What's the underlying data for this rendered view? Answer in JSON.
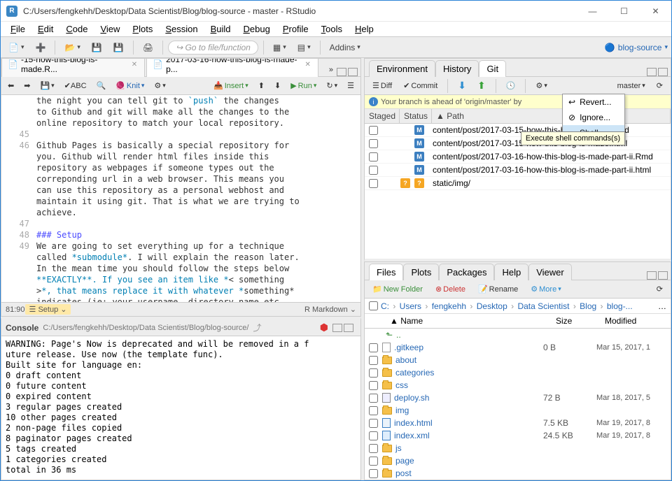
{
  "titlebar": {
    "text": "C:/Users/fengkehh/Desktop/Data Scientist/Blog/blog-source - master - RStudio"
  },
  "menu": [
    "File",
    "Edit",
    "Code",
    "View",
    "Plots",
    "Session",
    "Build",
    "Debug",
    "Profile",
    "Tools",
    "Help"
  ],
  "toolbar": {
    "goto": "Go to file/function",
    "addins": "Addins",
    "project": "blog-source"
  },
  "source": {
    "tabs": [
      {
        "label": "-15-how-this-blog-is-made.R...",
        "active": false
      },
      {
        "label": "2017-03-16-how-this-blog-is-made-p...",
        "active": true
      }
    ],
    "knit": "Knit",
    "insert": "Insert",
    "run": "Run",
    "lines": [
      {
        "n": "",
        "t": "the night you can tell git to `push` the changes\nto Github and git will make all the changes to the\nonline repository to match your local repository."
      },
      {
        "n": "45",
        "t": ""
      },
      {
        "n": "46",
        "t": "Github Pages is basically a special repository for\nyou. Github will render html files inside this\nrepository as webpages if someone types out the\ncorreponding url in a web browser. This means you\ncan use this repository as a personal webhost and\nmaintain it using git. That is what we are trying to\nachieve."
      },
      {
        "n": "47",
        "t": ""
      },
      {
        "n": "48",
        "t": "### Setup",
        "cls": "h3"
      },
      {
        "n": "49",
        "t": "We are going to set everything up for a technique\ncalled *submodule*. I will explain the reason later.\nIn the mean time you should follow the steps below\n**EXACTLY**. If you see an item like *< something\n>*, that means replace it with whatever *something*\nindicates (ie: your username, directory name etc"
      }
    ],
    "pos": "81:90",
    "chunk": "Setup",
    "lang": "R Markdown"
  },
  "console": {
    "title": "Console",
    "path": "C:/Users/fengkehh/Desktop/Data Scientist/Blog/blog-source/",
    "body": "WARNING: Page's Now is deprecated and will be removed in a f\nuture release. Use now (the template func).\nBuilt site for language en:\n0 draft content\n0 future content\n0 expired content\n3 regular pages created\n10 other pages created\n2 non-page files copied\n8 paginator pages created\n5 tags created\n1 categories created\ntotal in 36 ms"
  },
  "git": {
    "tabs": [
      "Environment",
      "History",
      "Git"
    ],
    "active_tab": 2,
    "diff": "Diff",
    "commit": "Commit",
    "branch": "master",
    "banner": "Your branch is ahead of 'origin/master' by",
    "menu": [
      "Revert...",
      "Ignore...",
      "Shell..."
    ],
    "tooltip": "Execute shell\ncommands(s)",
    "cols": [
      "Staged",
      "Status",
      "Path"
    ],
    "rows": [
      {
        "status": "M",
        "path": "content/post/2017-03-15-how-this-blog-is-made.Rmd"
      },
      {
        "status": "M",
        "path": "content/post/2017-03-15-how-this-blog-is-made.html"
      },
      {
        "status": "M",
        "path": "content/post/2017-03-16-how-this-blog-is-made-part-ii.Rmd"
      },
      {
        "status": "M",
        "path": "content/post/2017-03-16-how-this-blog-is-made-part-ii.html"
      },
      {
        "status": "?",
        "path": "static/img/"
      }
    ]
  },
  "files": {
    "tabs": [
      "Files",
      "Plots",
      "Packages",
      "Help",
      "Viewer"
    ],
    "active_tab": 0,
    "newfolder": "New Folder",
    "delete": "Delete",
    "rename": "Rename",
    "more": "More",
    "breadcrumb": [
      "C:",
      "Users",
      "fengkehh",
      "Desktop",
      "Data Scientist",
      "Blog",
      "blog-..."
    ],
    "cols": {
      "name": "Name",
      "size": "Size",
      "mod": "Modified"
    },
    "up": "..",
    "rows": [
      {
        "icon": "file",
        "name": ".gitkeep",
        "size": "0 B",
        "mod": "Mar 15, 2017, 1"
      },
      {
        "icon": "folder",
        "name": "about",
        "size": "",
        "mod": ""
      },
      {
        "icon": "folder",
        "name": "categories",
        "size": "",
        "mod": ""
      },
      {
        "icon": "folder",
        "name": "css",
        "size": "",
        "mod": ""
      },
      {
        "icon": "script",
        "name": "deploy.sh",
        "size": "72 B",
        "mod": "Mar 18, 2017, 5"
      },
      {
        "icon": "folder",
        "name": "img",
        "size": "",
        "mod": ""
      },
      {
        "icon": "html",
        "name": "index.html",
        "size": "7.5 KB",
        "mod": "Mar 19, 2017, 8"
      },
      {
        "icon": "xml",
        "name": "index.xml",
        "size": "24.5 KB",
        "mod": "Mar 19, 2017, 8"
      },
      {
        "icon": "folder",
        "name": "js",
        "size": "",
        "mod": ""
      },
      {
        "icon": "folder",
        "name": "page",
        "size": "",
        "mod": ""
      },
      {
        "icon": "folder",
        "name": "post",
        "size": "",
        "mod": ""
      }
    ]
  }
}
